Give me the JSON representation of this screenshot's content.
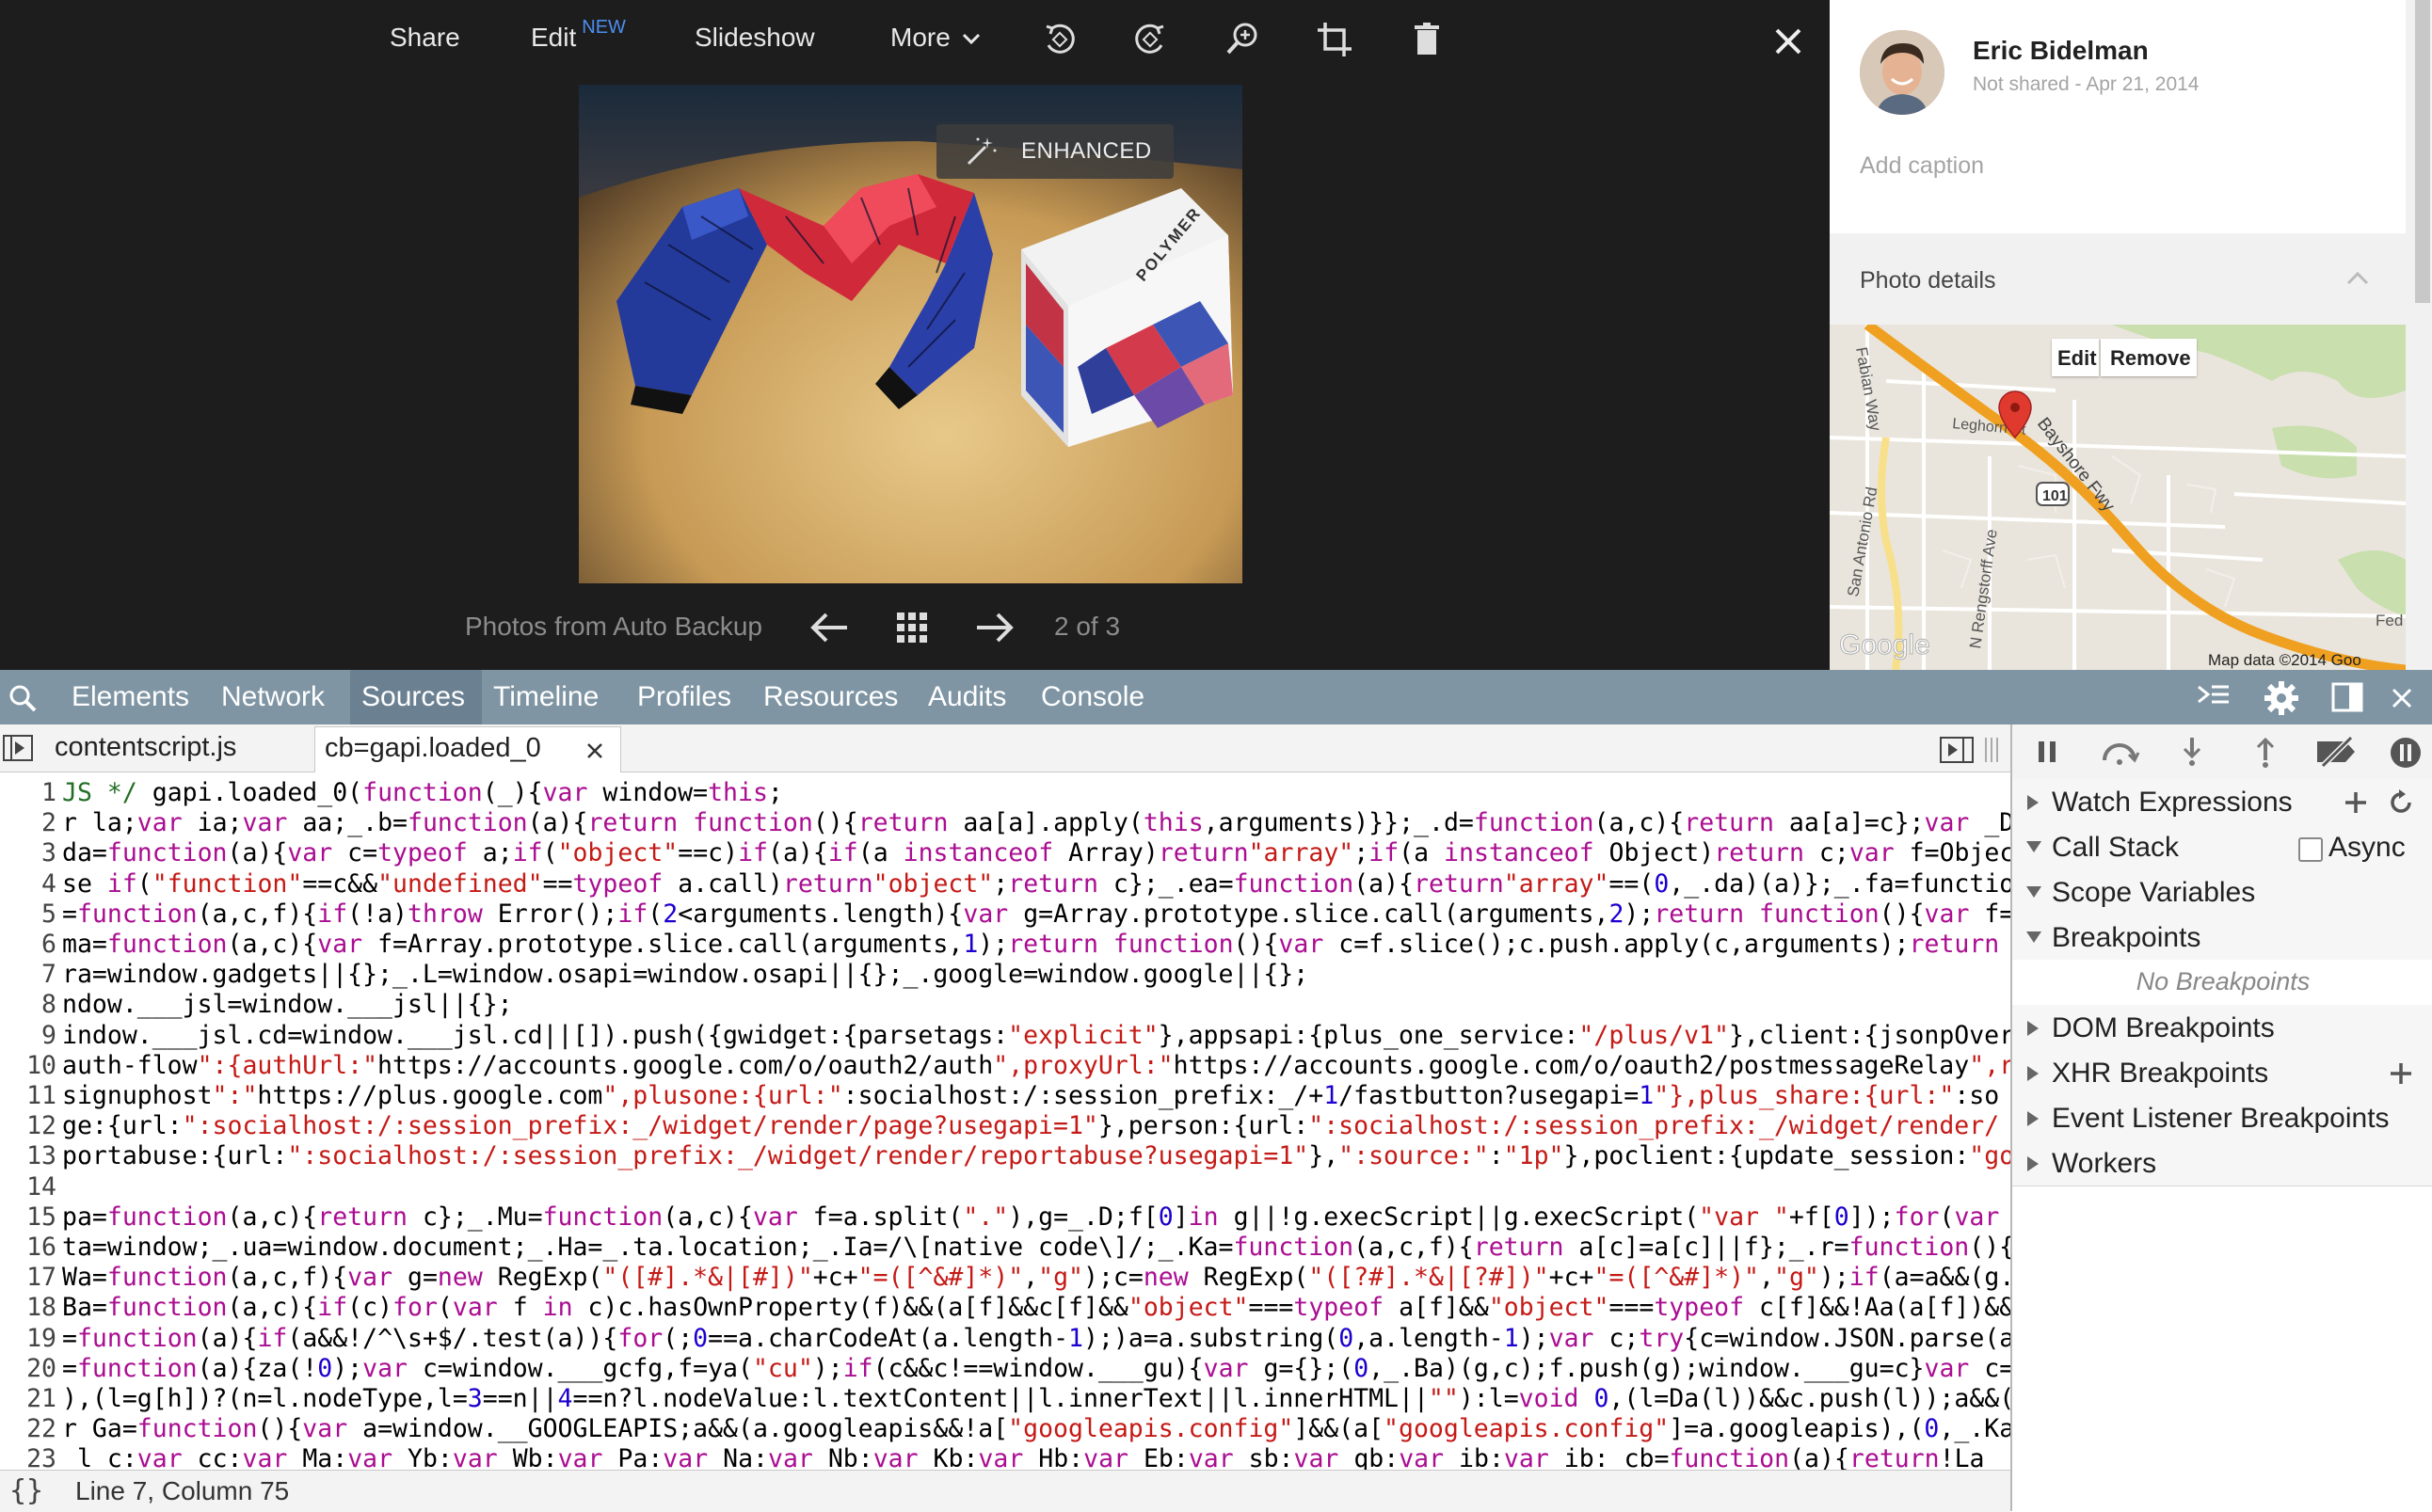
{
  "viewer": {
    "toolbar": {
      "share": "Share",
      "edit": "Edit",
      "edit_badge": "NEW",
      "slideshow": "Slideshow",
      "more": "More"
    },
    "enhanced_label": "ENHANCED",
    "album_label": "Photos from Auto Backup",
    "pager": "2 of 3",
    "photo_box_text": "POLYMER"
  },
  "info": {
    "owner_name": "Eric Bidelman",
    "shared_status": "Not shared - Apr 21, 2014",
    "caption_placeholder": "Add caption",
    "details_heading": "Photo details",
    "map": {
      "edit": "Edit",
      "remove": "Remove",
      "labels": [
        "Fabian Way",
        "Leghorn St",
        "Bayshore Fwy",
        "San Antonio Rd",
        "N Rengstorff Ave",
        "101",
        "Fed"
      ],
      "attribution": "Map data ©2014 Goo",
      "google": "Google"
    }
  },
  "devtools": {
    "tabs": [
      "Elements",
      "Network",
      "Sources",
      "Timeline",
      "Profiles",
      "Resources",
      "Audits",
      "Console"
    ],
    "active_tab": "Sources",
    "files": [
      "contentscript.js",
      "cb=gapi.loaded_0"
    ],
    "status": "Line 7, Column 75",
    "code_lines": [
      "JS */ gapi.loaded_0(function(_){var window=this;",
      "r la;var ia;var aa;_.b=function(a){return function(){return aa[a].apply(this,arguments)}};_.d=function(a,c){return aa[a]=c};var _D",
      "da=function(a){var c=typeof a;if(\"object\"==c)if(a){if(a instanceof Array)return\"array\";if(a instanceof Object)return c;var f=Objec",
      "se if(\"function\"==c&&\"undefined\"==typeof a.call)return\"object\";return c};_.ea=function(a){return\"array\"==(0,_.da)(a)};_.fa=functio",
      "=function(a,c,f){if(!a)throw Error();if(2<arguments.length){var g=Array.prototype.slice.call(arguments,2);return function(){var f=",
      "ma=function(a,c){var f=Array.prototype.slice.call(arguments,1);return function(){var c=f.slice();c.push.apply(c,arguments);return",
      "ra=window.gadgets||{};_.L=window.osapi=window.osapi||{};_.google=window.google||{};",
      "ndow.___jsl=window.___jsl||{};",
      "indow.___jsl.cd=window.___jsl.cd||[]).push({gwidget:{parsetags:\"explicit\"},appsapi:{plus_one_service:\"/plus/v1\"},client:{jsonpOver",
      "auth-flow\":{authUrl:\"https://accounts.google.com/o/oauth2/auth\",proxyUrl:\"https://accounts.google.com/o/oauth2/postmessageRelay\",r",
      "signuphost\":\"https://plus.google.com\",plusone:{url:\":socialhost:/:session_prefix:_/+1/fastbutton?usegapi=1\"},plus_share:{url:\":so",
      "ge:{url:\":socialhost:/:session_prefix:_/widget/render/page?usegapi=1\"},person:{url:\":socialhost:/:session_prefix:_/widget/render/",
      "portabuse:{url:\":socialhost:/:session_prefix:_/widget/render/reportabuse?usegapi=1\"},\":source:\":\"1p\"},poclient:{update_session:\"go",
      "",
      "pa=function(a,c){return c};_.Mu=function(a,c){var f=a.split(\".\"),g=_.D;f[0]in g||!g.execScript||g.execScript(\"var \"+f[0]);for(var",
      "ta=window;_.ua=window.document;_.Ha=_.ta.location;_.Ia=/\\[native code\\]/;_.Ka=function(a,c,f){return a[c]=a[c]||f};_.r=function(){",
      "Wa=function(a,c,f){var g=new RegExp(\"([#].*&|[#])\"+c+\"=([^&#]*)\",\"g\");c=new RegExp(\"([?#].*&|[?#])\"+c+\"=([^&#]*)\",\"g\");if(a=a&&(g.",
      "Ba=function(a,c){if(c)for(var f in c)c.hasOwnProperty(f)&&(a[f]&&c[f]&&\"object\"===typeof a[f]&&\"object\"===typeof c[f]&&!Aa(a[f])&&",
      "=function(a){if(a&&!/^\\s+$/.test(a)){for(;0==a.charCodeAt(a.length-1);)a=a.substring(0,a.length-1);var c;try{c=window.JSON.parse(a",
      "=function(a){za(!0);var c=window.___gcfg,f=ya(\"cu\");if(c&&c!==window.___gu){var g={};(0,_.Ba)(g,c);f.push(g);window.___gu=c}var c=",
      "),(l=g[h])?(n=l.nodeType,l=3==n||4==n?l.nodeValue:l.textContent||l.innerText||l.innerHTML||\"\"):l=void 0,(l=Da(l))&&c.push(l));a&&(",
      "r Ga=function(){var a=window.__GOOGLEAPIS;a&&(a.googleapis&&!a[\"googleapis.config\"]&&(a[\"googleapis.config\"]=a.googleapis),(0,_.Ka",
      "_l_c:var cc:var Ma:var Yb:var Wb:var Pa:var Na:var Nb:var Kb:var Hb:var Eb:var sb:var qb:var ib:var ib:_cb=function(a){return!La"
    ],
    "debugger": {
      "watch": "Watch Expressions",
      "callstack": "Call Stack",
      "async": "Async",
      "scope": "Scope Variables",
      "breakpoints": "Breakpoints",
      "no_breakpoints": "No Breakpoints",
      "dom_bp": "DOM Breakpoints",
      "xhr_bp": "XHR Breakpoints",
      "event_bp": "Event Listener Breakpoints",
      "workers": "Workers"
    }
  },
  "colors": {
    "viewer_bg": "#1d1d1d",
    "devtools_tabbar": "#7f95a4",
    "code_keyword": "#aa0d91",
    "code_string": "#c41a16",
    "code_number": "#1c00cf",
    "map_road": "#f0a020",
    "map_pin": "#e03a2e"
  },
  "icons": [
    "rotate-left-icon",
    "rotate-right-icon",
    "zoom-icon",
    "crop-icon",
    "trash-icon",
    "close-icon",
    "magic-wand-icon",
    "arrow-left-icon",
    "grid-icon",
    "arrow-right-icon",
    "chevron-up-icon",
    "map-pin-icon",
    "pause-icon",
    "step-over-icon",
    "step-into-icon",
    "step-out-icon",
    "deactivate-breakpoints-icon",
    "pause-on-exceptions-icon",
    "settings-gear-icon",
    "dock-icon",
    "console-drawer-icon",
    "add-icon",
    "refresh-icon"
  ]
}
